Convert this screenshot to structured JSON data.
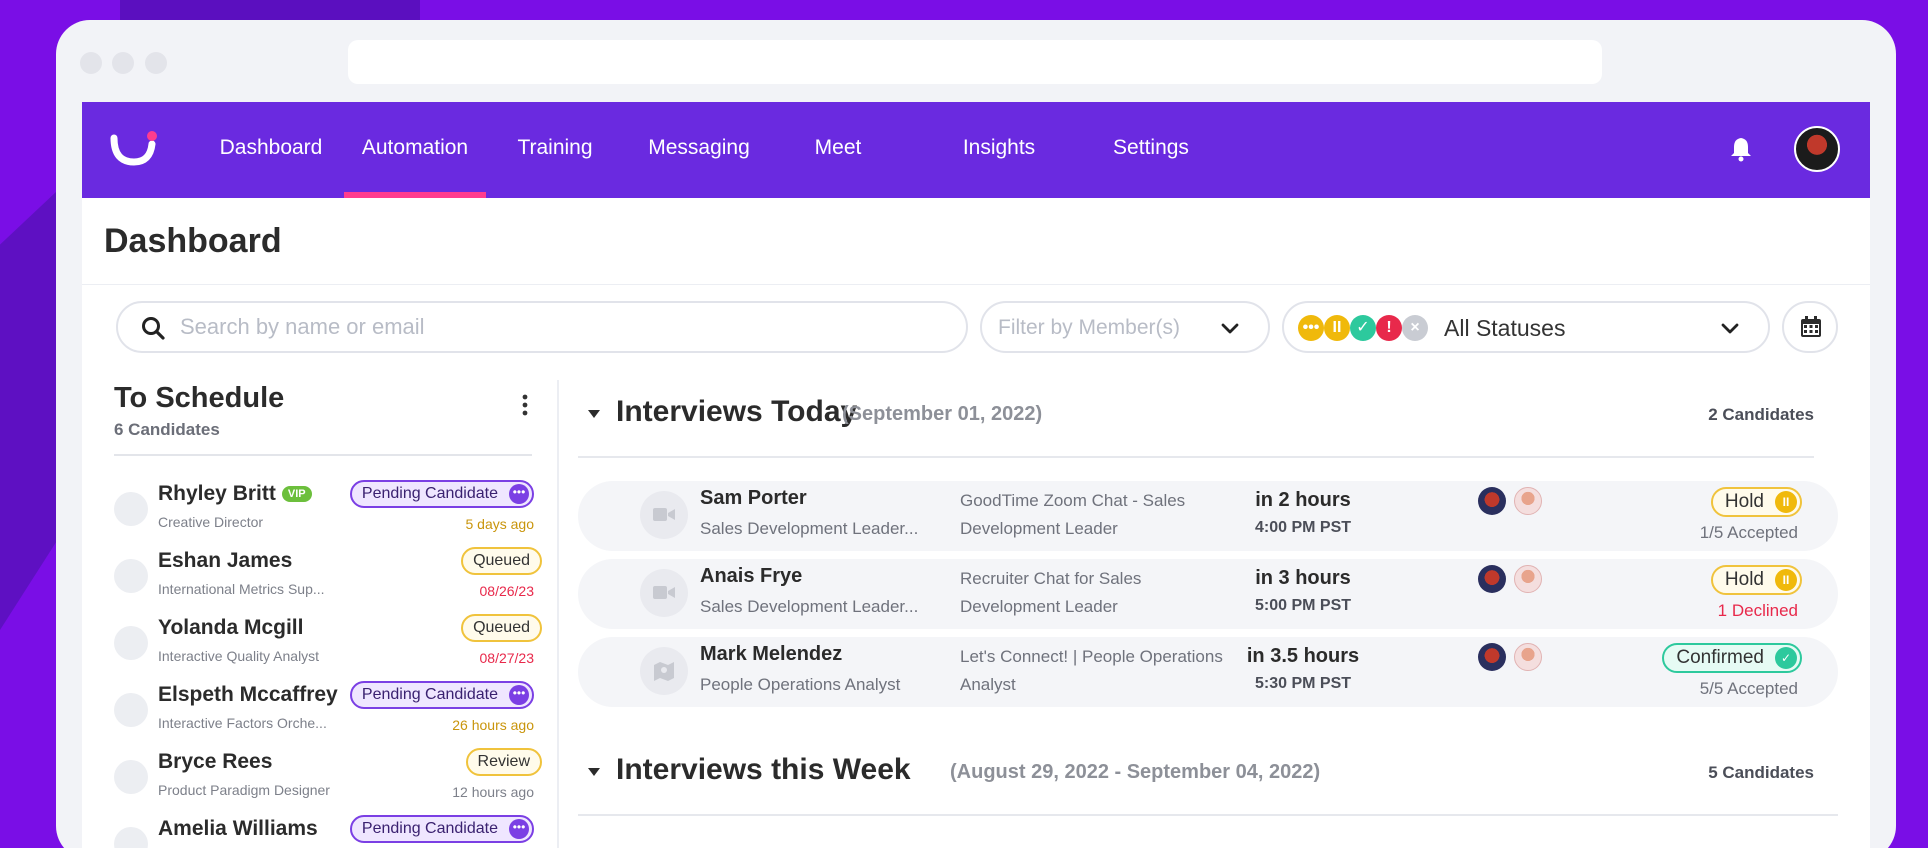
{
  "colors": {
    "accent": "#6a2ae0",
    "active_underline": "#ff3c8e",
    "pending": "#7b3fe4",
    "queued": "#f0c33c",
    "confirmed": "#2dc99d",
    "danger": "#e8294b",
    "warn_text": "#c9950c"
  },
  "nav": {
    "items": [
      {
        "label": "Dashboard"
      },
      {
        "label": "Automation",
        "active": true
      },
      {
        "label": "Training"
      },
      {
        "label": "Messaging"
      },
      {
        "label": "Meet"
      },
      {
        "label": "Insights"
      },
      {
        "label": "Settings"
      }
    ]
  },
  "page": {
    "title": "Dashboard"
  },
  "filters": {
    "search_placeholder": "Search by name or email",
    "member_placeholder": "Filter by Member(s)",
    "status_value": "All Statuses"
  },
  "to_schedule": {
    "title": "To Schedule",
    "count_label": "6 Candidates",
    "candidates": [
      {
        "name": "Rhyley Britt",
        "vip": "VIP",
        "role": "Creative Director",
        "badge": "Pending Candidate",
        "time": "5 days ago",
        "time_color": "#c9950c"
      },
      {
        "name": "Eshan James",
        "role": "International Metrics Sup...",
        "badge": "Queued",
        "time": "08/26/23",
        "time_color": "#e8294b"
      },
      {
        "name": "Yolanda Mcgill",
        "role": "Interactive Quality Analyst",
        "badge": "Queued",
        "time": "08/27/23",
        "time_color": "#e8294b"
      },
      {
        "name": "Elspeth Mccaffrey",
        "role": "Interactive Factors Orche...",
        "badge": "Pending Candidate",
        "time": "26 hours ago",
        "time_color": "#c9950c"
      },
      {
        "name": "Bryce Rees",
        "role": "Product Paradigm Designer",
        "badge": "Review",
        "time": "12 hours ago",
        "time_color": "#7d808a"
      },
      {
        "name": "Amelia Williams",
        "role": "",
        "badge": "Pending Candidate",
        "time": "",
        "time_color": "#7d808a"
      }
    ]
  },
  "today": {
    "title": "Interviews Today",
    "date": "(September 01, 2022)",
    "count_label": "2 Candidates",
    "rows": [
      {
        "name": "Sam Porter",
        "role": "Sales Development Leader...",
        "event_line1": "GoodTime Zoom Chat - Sales",
        "event_line2": "Development Leader",
        "relative": "in 2 hours",
        "time": "4:00 PM PST",
        "status": "Hold",
        "status_kind": "hold",
        "accepted": "1/5 Accepted",
        "accepted_red": false,
        "icon": "video-icon"
      },
      {
        "name": "Anais Frye",
        "role": "Sales Development Leader...",
        "event_line1": "Recruiter Chat for Sales",
        "event_line2": "Development Leader",
        "relative": "in 3 hours",
        "time": "5:00 PM PST",
        "status": "Hold",
        "status_kind": "hold",
        "accepted": "1 Declined",
        "accepted_red": true,
        "icon": "video-icon"
      },
      {
        "name": "Mark Melendez",
        "role": "People Operations Analyst",
        "event_line1": "Let's Connect! | People Operations",
        "event_line2": "Analyst",
        "relative": "in 3.5 hours",
        "time": "5:30 PM PST",
        "status": "Confirmed",
        "status_kind": "confirmed",
        "accepted": "5/5 Accepted",
        "accepted_red": false,
        "icon": "map-icon"
      }
    ]
  },
  "week": {
    "title": "Interviews this Week",
    "date": "(August 29, 2022 - September 04, 2022)",
    "count_label": "5 Candidates"
  }
}
